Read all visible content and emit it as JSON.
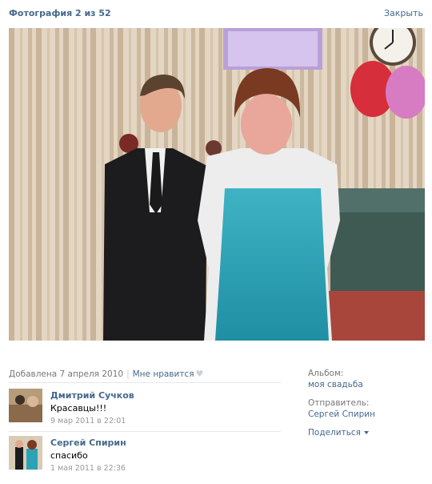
{
  "header": {
    "title": "Фотография 2 из 52",
    "close_label": "Закрыть"
  },
  "photo": {
    "icon": "wedding-photo"
  },
  "info": {
    "added": "Добавлена 7 апреля 2010",
    "separator": "|",
    "like_label": "Мне нравится",
    "heart_icon": "heart-icon"
  },
  "comments": [
    {
      "author": "Дмитрий Сучков",
      "text": "Красавцы!!!",
      "date": "9 мар 2011 в 22:01"
    },
    {
      "author": "Сергей Спирин",
      "text": "спасибо",
      "date": "1 мая 2011 в 22:36"
    }
  ],
  "sidebar": {
    "album_label": "Альбом:",
    "album_value": "моя свадьба",
    "sender_label": "Отправитель:",
    "sender_value": "Сергей Спирин",
    "share_label": "Поделиться"
  },
  "colors": {
    "link": "#45688e",
    "muted": "#777777",
    "divider": "#e4e8ed"
  }
}
